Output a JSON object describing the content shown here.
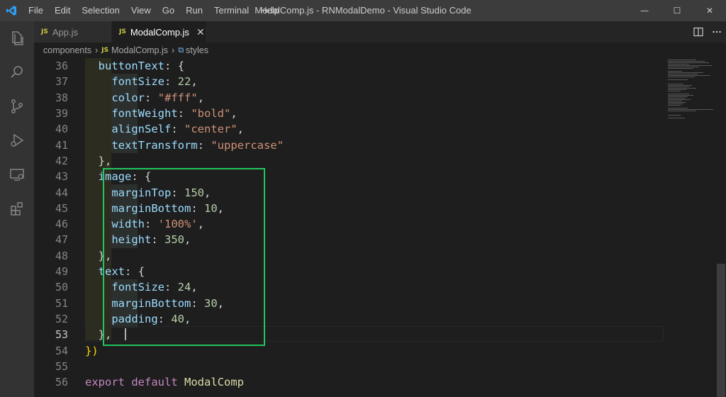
{
  "titlebar": {
    "menu": [
      "File",
      "Edit",
      "Selection",
      "View",
      "Go",
      "Run",
      "Terminal",
      "Help"
    ],
    "title": "ModalComp.js - RNModalDemo - Visual Studio Code",
    "minimize": "—",
    "maximize": "☐",
    "close": "✕"
  },
  "tabs": [
    {
      "badge": "JS",
      "label": "App.js",
      "active": false
    },
    {
      "badge": "JS",
      "label": "ModalComp.js",
      "active": true,
      "close": "✕"
    }
  ],
  "breadcrumb": {
    "folder": "components",
    "file_badge": "JS",
    "file": "ModalComp.js",
    "symbol": "styles"
  },
  "code_lines": [
    {
      "n": "36",
      "t": "  buttonText: {"
    },
    {
      "n": "37",
      "t": "    fontSize: 22,"
    },
    {
      "n": "38",
      "t": "    color: \"#fff\","
    },
    {
      "n": "39",
      "t": "    fontWeight: \"bold\","
    },
    {
      "n": "40",
      "t": "    alignSelf: \"center\","
    },
    {
      "n": "41",
      "t": "    textTransform: \"uppercase\""
    },
    {
      "n": "42",
      "t": "  },"
    },
    {
      "n": "43",
      "t": "  image: {"
    },
    {
      "n": "44",
      "t": "    marginTop: 150,"
    },
    {
      "n": "45",
      "t": "    marginBottom: 10,"
    },
    {
      "n": "46",
      "t": "    width: '100%',"
    },
    {
      "n": "47",
      "t": "    height: 350,"
    },
    {
      "n": "48",
      "t": "  },"
    },
    {
      "n": "49",
      "t": "  text: {"
    },
    {
      "n": "50",
      "t": "    fontSize: 24,"
    },
    {
      "n": "51",
      "t": "    marginBottom: 30,"
    },
    {
      "n": "52",
      "t": "    padding: 40,"
    },
    {
      "n": "53",
      "t": "  },"
    },
    {
      "n": "54",
      "t": "})"
    },
    {
      "n": "55",
      "t": ""
    },
    {
      "n": "56",
      "t": "export default ModalComp"
    }
  ],
  "current_line": "53",
  "colors": {
    "highlight_box": "#22c55e",
    "vscode_blue": "#0078d4",
    "js_badge": "#cbcb41"
  }
}
